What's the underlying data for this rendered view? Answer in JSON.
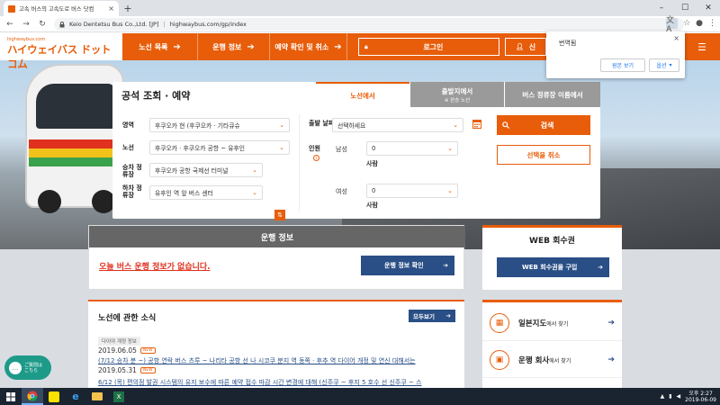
{
  "browser": {
    "tab_title": "고속 버스의 고속도로 버스 닷컴",
    "site_label": "Keio Dentetsu Bus Co.,Ltd. [JP]",
    "url": "highwaybus.com/gp/index"
  },
  "translate_popup": {
    "title": "번역됨",
    "show_original": "원본 보기",
    "options": "옵션"
  },
  "header": {
    "logo_small": "highwaybus.com",
    "logo_main": "ハイウェイバス ドットコム",
    "nav": [
      "노선 목록",
      "운행 정보",
      "예약 확인 및 취소"
    ],
    "login": "로그인",
    "signup": "신"
  },
  "search": {
    "title": "공석 조회 · 예약",
    "tabs": [
      {
        "label": "노선에서",
        "sub": ""
      },
      {
        "label": "출발지에서",
        "sub": "※ 완승 노선"
      },
      {
        "label": "버스 정류장 이름에서",
        "sub": ""
      }
    ],
    "area_label": "영역",
    "area_value": "후쿠오카 현 (후쿠오카 · 기타큐슈",
    "route_label": "노선",
    "route_value": "후쿠오카 · 후쿠오카 공항 ~ 유후인",
    "board_label": "승차 정류장",
    "board_value": "후쿠오카 공항 국제선 터미널",
    "alight_label": "하차 정류장",
    "alight_value": "유후인 역 앞 버스 센터",
    "depart_label": "출발 날짜",
    "depart_placeholder": "선택하세요",
    "people_label": "인원",
    "male_label": "남성",
    "male_value": "0",
    "female_label": "여성",
    "female_value": "0",
    "unit": "사람",
    "search_button": "검색",
    "cancel_button": "선택을 취소"
  },
  "operation": {
    "header": "운행 정보",
    "message": "오늘 버스 운행 정보가 없습니다.",
    "button": "운행 정보 확인"
  },
  "web_ticket": {
    "header": "WEB 회수권",
    "button": "WEB 회수권을 구입"
  },
  "news": {
    "header": "노선에 관한 소식",
    "more": "모두보기",
    "tag": "다이야 개정 정보",
    "new_badge": "NEW",
    "items": [
      {
        "date": "2019.06.05",
        "text": "(7/12 승차 분 ~) 공항 연락 버스 츠루 ~ 나리타 공항 선 나 시코쿠 분지 역 동쪽 · 후추 역 다이어 개정 및 연신 대해서는"
      },
      {
        "date": "2019.05.31",
        "text": "6/12 (목) 편의점 발권 시스템의 유지 보수에 따른 예약 접수 마감 시간 변경에 대해 (신주쿠 ~ 후지 5 호수 선 신주쿠 ~ 스"
      }
    ]
  },
  "side_links": [
    {
      "main": "일본지도",
      "small": "에서 찾기"
    },
    {
      "main": "운행 회사",
      "small": "에서 찾기"
    }
  ],
  "chat": {
    "line1": "ご質問は",
    "line2": "こちら"
  },
  "taskbar": {
    "time": "오후 2:27",
    "date": "2019-06-09"
  }
}
